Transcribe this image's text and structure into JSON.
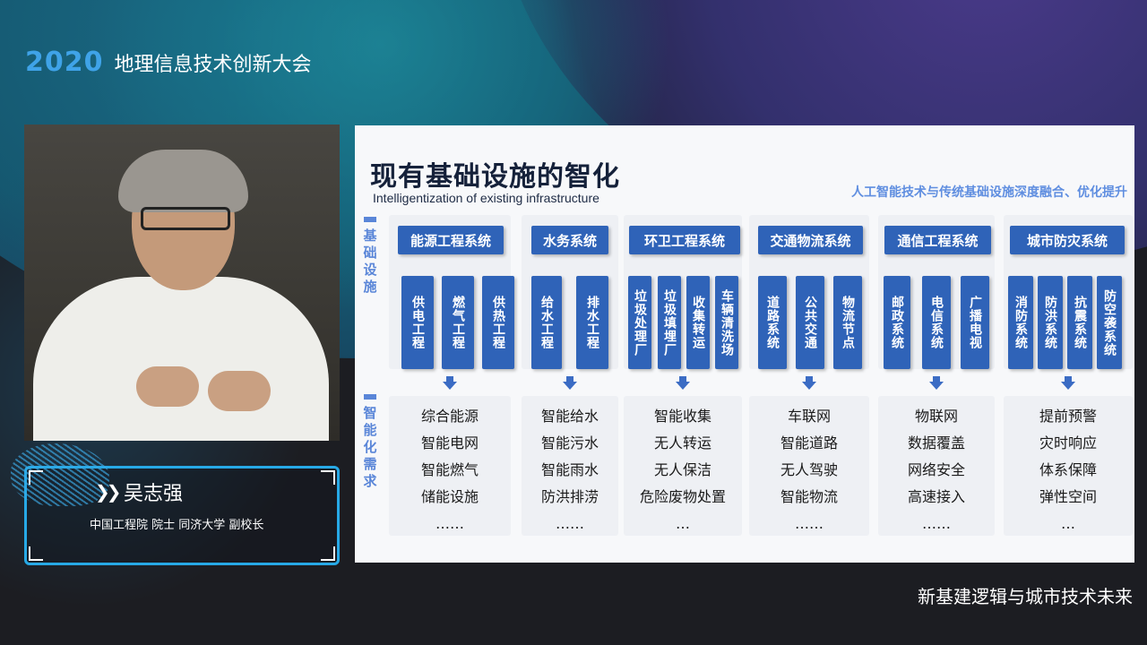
{
  "header": {
    "year": "2020",
    "conference": "地理信息技术创新大会"
  },
  "speaker": {
    "name": "吴志强",
    "title": "中国工程院 院士  同济大学 副校长"
  },
  "footer": {
    "topic": "新基建逻辑与城市技术未来"
  },
  "slide": {
    "title": "现有基础设施的智化",
    "subtitle": "Intelligentization of existing infrastructure",
    "tagline": "人工智能技术与传统基础设施深度融合、优化提升",
    "label_top": "基础设施",
    "label_bottom": "智能化需求",
    "columns": [
      {
        "header": "能源工程系统",
        "subs": [
          "供电工程",
          "燃气工程",
          "供热工程"
        ],
        "items": [
          "综合能源",
          "智能电网",
          "智能燃气",
          "储能设施",
          "……"
        ]
      },
      {
        "header": "水务系统",
        "subs": [
          "给水工程",
          "排水工程"
        ],
        "items": [
          "智能给水",
          "智能污水",
          "智能雨水",
          "防洪排涝",
          "……"
        ]
      },
      {
        "header": "环卫工程系统",
        "subs": [
          "垃圾处理厂",
          "垃圾填埋厂",
          "收集转运",
          "车辆清洗场"
        ],
        "items": [
          "智能收集",
          "无人转运",
          "无人保洁",
          "危险废物处置",
          "…"
        ]
      },
      {
        "header": "交通物流系统",
        "subs": [
          "道路系统",
          "公共交通",
          "物流节点"
        ],
        "items": [
          "车联网",
          "智能道路",
          "无人驾驶",
          "智能物流",
          "……"
        ]
      },
      {
        "header": "通信工程系统",
        "subs": [
          "邮政系统",
          "电信系统",
          "广播电视"
        ],
        "items": [
          "物联网",
          "数据覆盖",
          "网络安全",
          "高速接入",
          "……"
        ]
      },
      {
        "header": "城市防灾系统",
        "subs": [
          "消防系统",
          "防洪系统",
          "抗震系统",
          "防空袭系统"
        ],
        "items": [
          "提前预警",
          "灾时响应",
          "体系保障",
          "弹性空间",
          "…"
        ]
      }
    ]
  },
  "colors": {
    "accent": "#2f63b8",
    "brand": "#3fa3e8",
    "frame": "#27a9e6"
  }
}
